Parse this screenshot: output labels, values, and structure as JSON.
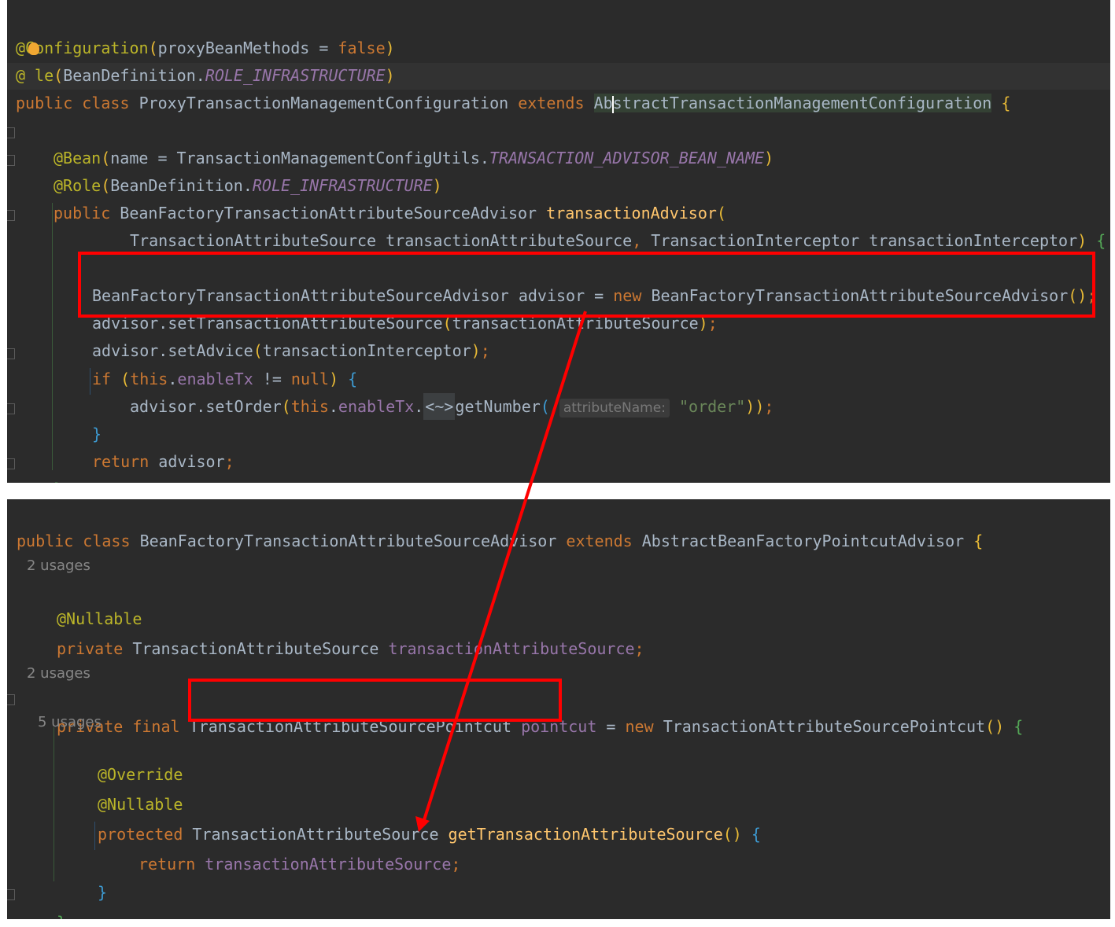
{
  "panel1": {
    "l1": {
      "annotation": "@Configuration",
      "open": "(",
      "param": "proxyBeanMethods",
      "eq": " = ",
      "value": "false",
      "close": ")"
    },
    "l2": {
      "annotation_a": "@",
      "annotation_b": "le",
      "open": "(",
      "cls": "BeanDefinition.",
      "constant": "ROLE_INFRASTRUCTURE",
      "close": ")"
    },
    "l3": {
      "kw1": "public",
      "kw2": "class",
      "name": "ProxyTransactionManagementConfiguration",
      "kw3": "extends",
      "super_a": "Ab",
      "super_b": "stractTransactionManagementConfiguration",
      "brace": "{"
    },
    "l4": {
      "annotation": "@Bean",
      "open": "(",
      "param": "name = TransactionManagementConfigUtils.",
      "constant": "TRANSACTION_ADVISOR_BEAN_NAME",
      "close": ")"
    },
    "l5": {
      "annotation": "@Role",
      "open": "(",
      "cls": "BeanDefinition.",
      "constant": "ROLE_INFRASTRUCTURE",
      "close": ")"
    },
    "l6": {
      "kw": "public",
      "type": "BeanFactoryTransactionAttributeSourceAdvisor",
      "method": "transactionAdvisor",
      "open": "("
    },
    "l7": {
      "params": "TransactionAttributeSource transactionAttributeSource",
      "comma": ", ",
      "params2": "TransactionInterceptor transactionInterceptor",
      "close": ")",
      "brace": "{"
    },
    "l8": {
      "lhs": "BeanFactoryTransactionAttributeSourceAdvisor advisor = ",
      "kw": "new",
      "rhs": "BeanFactoryTransactionAttributeSourceAdvisor",
      "parens": "()",
      "semi": ";"
    },
    "l9": {
      "call": "advisor.setTransactionAttributeSource",
      "open": "(",
      "arg": "transactionAttributeSource",
      "close": ")",
      "semi": ";"
    },
    "l10": {
      "call": "advisor.setAdvice",
      "open": "(",
      "arg": "transactionInterceptor",
      "close": ")",
      "semi": ";"
    },
    "l11": {
      "kw": "if",
      "open": "(",
      "this": "this",
      "dot": ".",
      "field": "enableTx",
      "op": " != ",
      "null": "null",
      "close": ")",
      "brace": "{"
    },
    "l12": {
      "call": "advisor.setOrder",
      "open": "(",
      "this": "this",
      "dot": ".",
      "field": "enableTx",
      "dot2": ".",
      "fold": "<~>",
      "method": "getNumber",
      "open2": "(",
      "hint": "attributeName:",
      "str": "\"order\"",
      "close": "))",
      "semi": ";"
    },
    "l13": {
      "brace": "}"
    },
    "l14": {
      "kw": "return",
      "var": "advisor",
      "semi": ";"
    },
    "l15": {
      "brace": "}"
    }
  },
  "panel2": {
    "l1": {
      "kw1": "public",
      "kw2": "class",
      "name": "BeanFactoryTransactionAttributeSourceAdvisor",
      "kw3": "extends",
      "super": "AbstractBeanFactoryPointcutAdvisor",
      "brace": "{"
    },
    "usages1": "2 usages",
    "l2": {
      "annotation": "@Nullable"
    },
    "l3": {
      "kw": "private",
      "type": "TransactionAttributeSource",
      "field": "transactionAttributeSource",
      "semi": ";"
    },
    "usages2": "2 usages",
    "l4": {
      "kw1": "private",
      "kw2": "final",
      "type": "TransactionAttributeSourcePointcut",
      "field": "pointcut",
      "eq": " = ",
      "kw3": "new",
      "ctor": "TransactionAttributeSourcePointcut",
      "parens": "()",
      "brace": "{"
    },
    "usages3": "5 usages",
    "l5": {
      "annotation": "@Override"
    },
    "l6": {
      "annotation": "@Nullable"
    },
    "l7": {
      "kw": "protected",
      "type": "TransactionAttributeSource",
      "method": "getTransactionAttributeSource",
      "parens": "()",
      "brace": "{"
    },
    "l8": {
      "kw": "return",
      "field": "transactionAttributeSource",
      "semi": ";"
    },
    "l9": {
      "brace": "}"
    },
    "l10": {
      "brace": "}",
      "semi": ";"
    }
  },
  "colors": {
    "background": "#2b2b2b",
    "keyword": "#cc7832",
    "annotation": "#bbb529",
    "field": "#9876aa",
    "method": "#ffc66d",
    "string": "#6a8759",
    "text": "#a9b7c6",
    "highlight_box": "#ff0000"
  }
}
